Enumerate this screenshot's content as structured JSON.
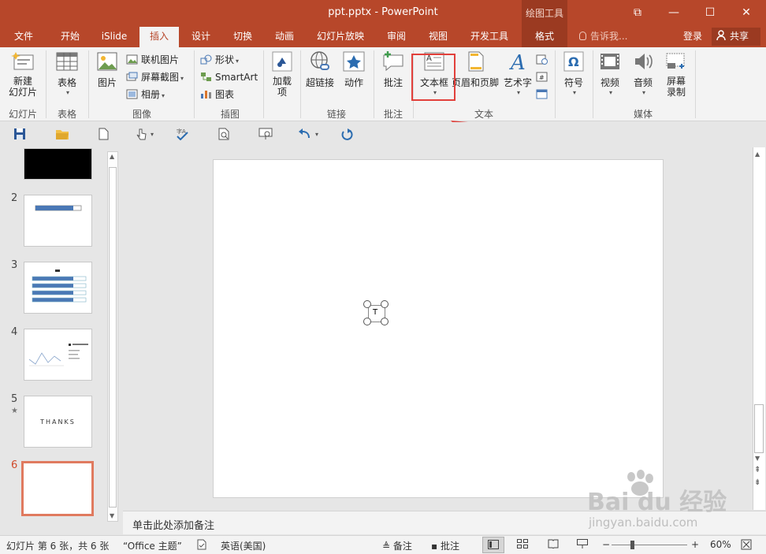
{
  "window": {
    "title": "ppt.pptx - PowerPoint",
    "context_group": "绘图工具",
    "controls": {
      "restore_ribbon": "⧉",
      "minimize": "—",
      "maximize": "☐",
      "close": "✕"
    }
  },
  "tabs": [
    {
      "label": "文件"
    },
    {
      "label": "开始"
    },
    {
      "label": "iSlide"
    },
    {
      "label": "插入",
      "active": true
    },
    {
      "label": "设计"
    },
    {
      "label": "切换"
    },
    {
      "label": "动画"
    },
    {
      "label": "幻灯片放映"
    },
    {
      "label": "审阅"
    },
    {
      "label": "视图"
    },
    {
      "label": "开发工具"
    },
    {
      "label": "格式"
    }
  ],
  "tell_me": "告诉我...",
  "login": "登录",
  "share": "共享",
  "ribbon": {
    "new_slide": "新建\n幻灯片",
    "table": "表格",
    "picture": "图片",
    "online_picture": "联机图片",
    "screenshot": "屏幕截图",
    "album": "相册",
    "shapes": "形状",
    "smartart": "SmartArt",
    "chart": "图表",
    "addin": "加载\n项",
    "hyperlink": "超链接",
    "action": "动作",
    "comment": "批注",
    "textbox": "文本框",
    "header_footer": "页眉和页脚",
    "wordart": "艺术字",
    "symbol": "符号",
    "video": "视频",
    "audio": "音频",
    "screen_record": "屏幕\n录制",
    "groups": {
      "slides": "幻灯片",
      "tables": "表格",
      "images": "图像",
      "illustrations": "插图",
      "links": "链接",
      "comments": "批注",
      "text": "文本",
      "media": "媒体"
    }
  },
  "slides": [
    {
      "num": "",
      "type": "black"
    },
    {
      "num": "2",
      "type": "bar"
    },
    {
      "num": "3",
      "type": "list"
    },
    {
      "num": "4",
      "type": "chart"
    },
    {
      "num": "5",
      "type": "thanks",
      "text": "THANKS",
      "star": "★"
    },
    {
      "num": "6",
      "type": "blank",
      "selected": true
    }
  ],
  "textbox_cursor": "T",
  "notes_placeholder": "单击此处添加备注",
  "status": {
    "slide_info": "幻灯片 第 6 张，共 6 张",
    "theme": "“Office 主题”",
    "language": "英语(美国)",
    "notes": "备注",
    "comments": "批注",
    "zoom": "60%"
  },
  "watermark": {
    "brand": "Bai du 经验",
    "url": "jingyan.baidu.com"
  },
  "colors": {
    "accent": "#b7472a",
    "highlight": "#e2403b",
    "selected_thumb": "#e07a5f"
  }
}
